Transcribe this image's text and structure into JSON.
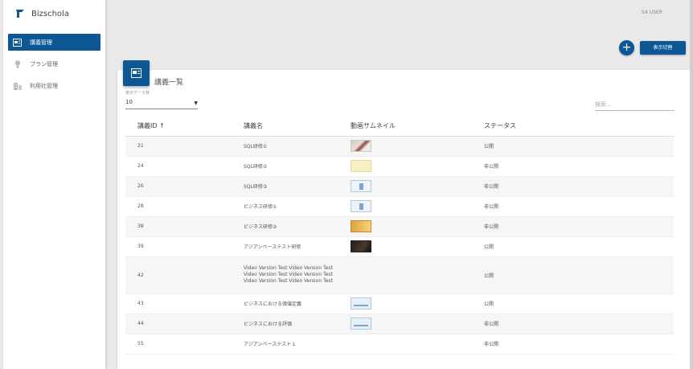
{
  "app": {
    "brand": "Bizschola"
  },
  "sidebar": {
    "items": [
      {
        "label": "講義管理",
        "icon": "lecture-icon",
        "active": true
      },
      {
        "label": "プラン管理",
        "icon": "lightbulb-icon",
        "active": false
      },
      {
        "label": "利用社管理",
        "icon": "building-icon",
        "active": false
      }
    ]
  },
  "header": {
    "user": "SA USER",
    "add_button": "+",
    "switch_button": "表示切替"
  },
  "card": {
    "title": "講義一覧",
    "show_count_label": "表示データ数",
    "show_count_value": "10",
    "search_placeholder": "検索..."
  },
  "table": {
    "columns": [
      "講義ID ↑",
      "講義名",
      "動画サムネイル",
      "ステータス"
    ],
    "rows": [
      {
        "id": "21",
        "name": "SQL研修①",
        "thumb": "t-photo",
        "status": "公開"
      },
      {
        "id": "24",
        "name": "SQL研修②",
        "thumb": "t-yellow",
        "status": "非公開"
      },
      {
        "id": "26",
        "name": "SQL研修③",
        "thumb": "t-doc",
        "status": "非公開"
      },
      {
        "id": "28",
        "name": "ビジネス研修①",
        "thumb": "t-doc",
        "status": "非公開"
      },
      {
        "id": "38",
        "name": "ビジネス研修②",
        "thumb": "t-orange",
        "status": "非公開"
      },
      {
        "id": "39",
        "name": "アジアンベーステスト研修",
        "thumb": "t-dark",
        "status": "公開"
      },
      {
        "id": "42",
        "name": "Video Version Test Video Version Test Video Version Test Video Version Test Video Version Test Video Version Test",
        "thumb": "",
        "status": "公開"
      },
      {
        "id": "43",
        "name": "ビジネスにおける価値定義",
        "thumb": "t-doc2",
        "status": "公開"
      },
      {
        "id": "44",
        "name": "ビジネスにおける評価",
        "thumb": "t-doc2",
        "status": "非公開"
      },
      {
        "id": "55",
        "name": "アジアンベーステスト１",
        "thumb": "",
        "status": "非公開"
      }
    ]
  },
  "colors": {
    "primary": "#0d5795",
    "background": "#e9e9e9"
  }
}
